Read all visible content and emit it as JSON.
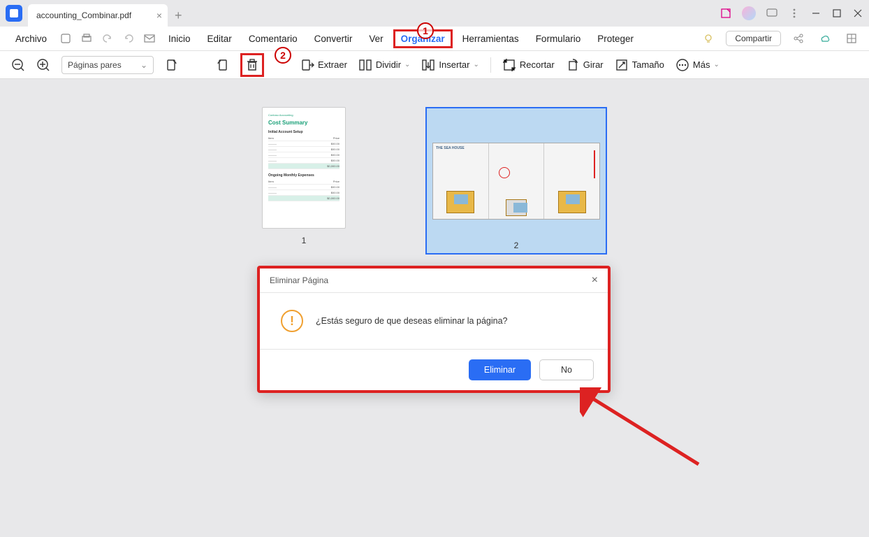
{
  "titlebar": {
    "filename": "accounting_Combinar.pdf"
  },
  "menu": {
    "archivo": "Archivo",
    "inicio": "Inicio",
    "editar": "Editar",
    "comentario": "Comentario",
    "convertir": "Convertir",
    "ver": "Ver",
    "organizar": "Organizar",
    "herramientas": "Herramientas",
    "formulario": "Formulario",
    "proteger": "Proteger",
    "compartir": "Compartir"
  },
  "toolbar": {
    "pagerange": "Páginas pares",
    "extraer": "Extraer",
    "dividir": "Dividir",
    "insertar": "Insertar",
    "recortar": "Recortar",
    "girar": "Girar",
    "tamano": "Tamaño",
    "mas": "Más"
  },
  "thumbs": {
    "page1_num": "1",
    "page2_num": "2",
    "doc1_brand": "Contoso Accounting",
    "doc1_title": "Cost Summary",
    "doc1_sec1": "Initial Account Setup",
    "doc1_sec2": "Ongoing Monthly Expenses",
    "doc2_title": "THE SEA HOUSE"
  },
  "dialog": {
    "title": "Eliminar Página",
    "message": "¿Estás seguro de que deseas eliminar la página?",
    "confirm": "Eliminar",
    "cancel": "No"
  },
  "callouts": {
    "c1": "1",
    "c2": "2"
  }
}
